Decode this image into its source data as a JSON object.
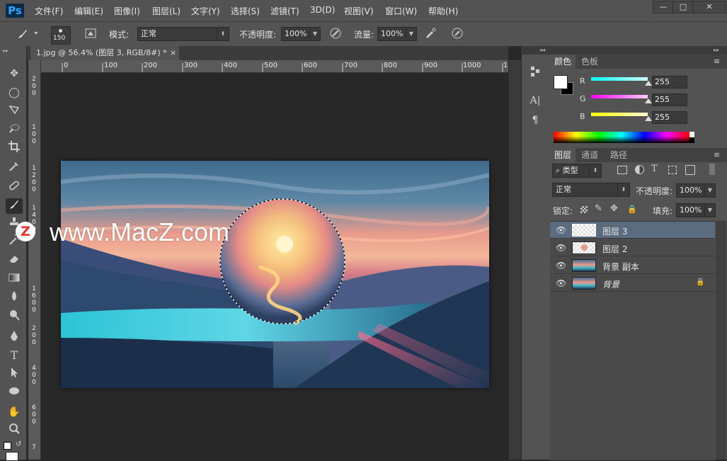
{
  "app": {
    "logo": "Ps"
  },
  "menubar": {
    "items": [
      "文件(F)",
      "编辑(E)",
      "图像(I)",
      "图层(L)",
      "文字(Y)",
      "选择(S)",
      "滤镜(T)",
      "3D(D)",
      "视图(V)",
      "窗口(W)",
      "帮助(H)"
    ],
    "window_controls": {
      "minimize": "—",
      "maximize": "□",
      "close": "✕"
    }
  },
  "options_bar": {
    "brush_size": "150",
    "mode_label": "模式:",
    "mode_value": "正常",
    "opacity_label": "不透明度:",
    "opacity_value": "100%",
    "flow_label": "流量:",
    "flow_value": "100%"
  },
  "document": {
    "tab_title": "1.jpg @ 56.4% (图层 3, RGB/8#) *",
    "tab_close": "×",
    "ruler_top": [
      "0",
      "100",
      "200",
      "300",
      "400",
      "500",
      "600",
      "700",
      "800",
      "900",
      "1000",
      "1"
    ],
    "ruler_left": [
      "2",
      "0",
      "0",
      "1",
      "0",
      "0",
      "1",
      "2",
      "0",
      "0",
      "1",
      "4",
      "0",
      "0",
      "1",
      "6",
      "0",
      "0",
      "2",
      "0",
      "0",
      "4",
      "0",
      "0",
      "6",
      "0",
      "0",
      "7"
    ]
  },
  "watermark": {
    "letter": "Z",
    "text": "www.MacZ.com"
  },
  "color_panel": {
    "tabs": [
      "颜色",
      "色板"
    ],
    "channels": [
      {
        "name": "R",
        "value": "255",
        "color": "#00e5ff"
      },
      {
        "name": "G",
        "value": "255",
        "color": "#ff33ff"
      },
      {
        "name": "B",
        "value": "255",
        "color": "#ffff33"
      }
    ],
    "foreground": "#ffffff",
    "background": "#000000"
  },
  "layers_panel": {
    "tabs": [
      "图层",
      "通道",
      "路径"
    ],
    "filter_label": "类型",
    "blend_mode": "正常",
    "opacity_label": "不透明度:",
    "opacity_value": "100%",
    "lock_label": "锁定:",
    "fill_label": "填充:",
    "fill_value": "100%",
    "layers": [
      {
        "name": "图层 3",
        "selected": true,
        "kind": "transparent"
      },
      {
        "name": "图层 2",
        "selected": false,
        "kind": "transparent"
      },
      {
        "name": "背景 副本",
        "selected": false,
        "kind": "image"
      },
      {
        "name": "背景",
        "selected": false,
        "kind": "image",
        "locked": true
      }
    ]
  }
}
